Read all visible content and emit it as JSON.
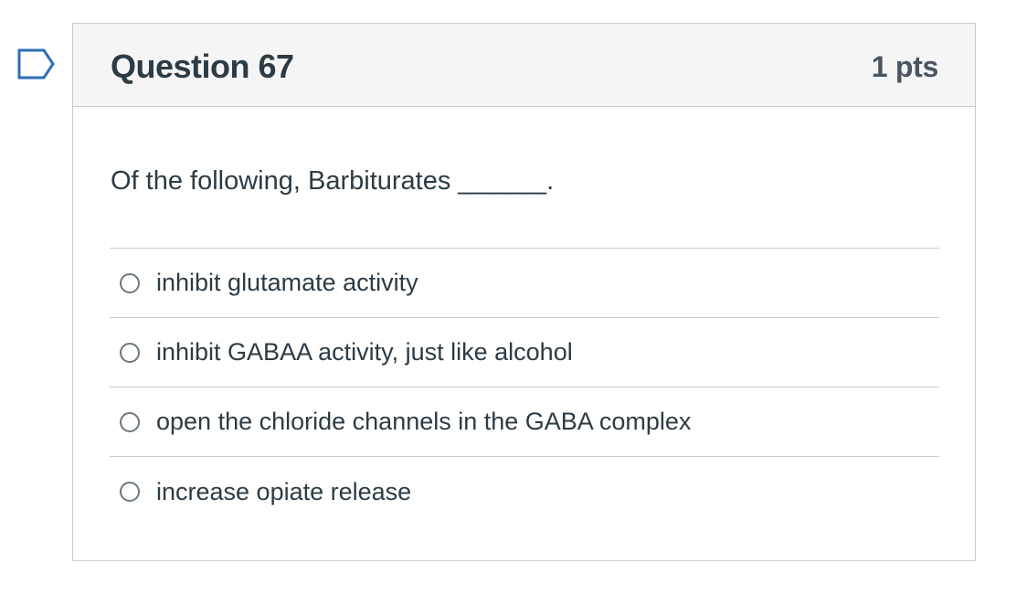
{
  "question": {
    "title": "Question 67",
    "points": "1 pts",
    "text": "Of the following, Barbiturates ______.",
    "flag_icon": "flag-outline-icon"
  },
  "answers": [
    {
      "label": "inhibit glutamate activity",
      "selected": false
    },
    {
      "label": "inhibit GABAA activity, just like alcohol",
      "selected": false
    },
    {
      "label": "open the chloride channels in the GABA complex",
      "selected": false
    },
    {
      "label": "increase opiate release",
      "selected": false
    }
  ],
  "colors": {
    "text": "#2d3b45",
    "border": "#c7cdd1",
    "header_bg": "#f5f5f5",
    "flag_stroke": "#2d6fb8"
  }
}
